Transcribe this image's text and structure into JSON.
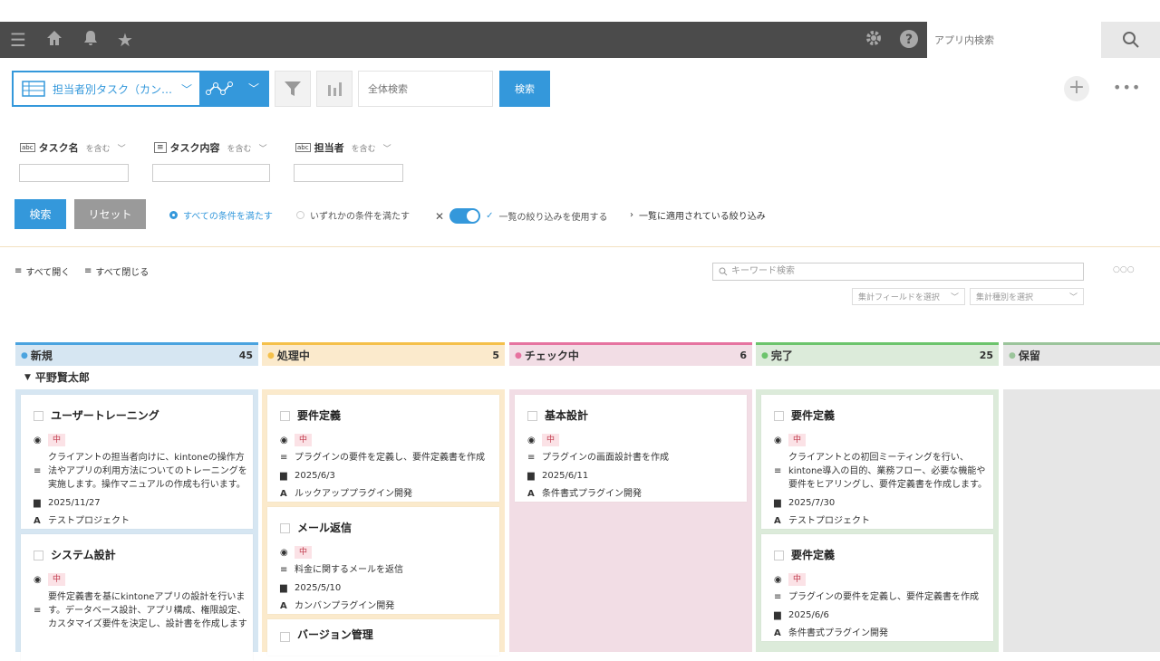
{
  "header": {
    "search_placeholder": "アプリ内検索"
  },
  "toolbar": {
    "view_label": "担当者別タスク（カン…",
    "allsearch_placeholder": "全体検索",
    "search_label": "検索"
  },
  "filters": {
    "fields": [
      {
        "label": "タスク名",
        "op": "を含む"
      },
      {
        "label": "タスク内容",
        "op": "を含む"
      },
      {
        "label": "担当者",
        "op": "を含む"
      }
    ],
    "search_label": "検索",
    "reset_label": "リセット",
    "match_all": "すべての条件を満たす",
    "match_any": "いずれかの条件を満たす",
    "use_list_filter": "一覧の絞り込みを使用する",
    "applied_filter": "一覧に適用されている絞り込み"
  },
  "kanban_bar": {
    "expand_all": "すべて開く",
    "collapse_all": "すべて閉じる",
    "keyword_placeholder": "キーワード検索",
    "agg_field": "集計フィールドを選択",
    "agg_type": "集計種別を選択"
  },
  "group": {
    "name": "平野賢太郎"
  },
  "columns": [
    {
      "name": "新規",
      "count": "45",
      "color": "#4aa3df",
      "bg": "#d6e6f2"
    },
    {
      "name": "処理中",
      "count": "5",
      "color": "#f5c04a",
      "bg": "#fbeacc"
    },
    {
      "name": "チェック中",
      "count": "6",
      "color": "#e673a0",
      "bg": "#f2dde5"
    },
    {
      "name": "完了",
      "count": "25",
      "color": "#6cc46c",
      "bg": "#dcebda"
    },
    {
      "name": "保留",
      "count": "",
      "color": "#9bc49b",
      "bg": "#e6e6e6"
    }
  ],
  "cards": {
    "c0": [
      {
        "title": "ユーザートレーニング",
        "priority": "中",
        "desc": "クライアントの担当者向けに、kintoneの操作方法やアプリの利用方法についてのトレーニングを実施します。操作マニュアルの作成も行います。",
        "date": "2025/11/27",
        "project": "テストプロジェクト"
      },
      {
        "title": "システム設計",
        "priority": "中",
        "desc": "要件定義書を基にkintoneアプリの設計を行います。データベース設計、アプリ構成、権限設定、カスタマイズ要件を決定し、設計書を作成します"
      }
    ],
    "c1": [
      {
        "title": "要件定義",
        "priority": "中",
        "desc": "プラグインの要件を定義し、要件定義書を作成",
        "date": "2025/6/3",
        "project": "ルックアッププラグイン開発"
      },
      {
        "title": "メール返信",
        "priority": "中",
        "desc": "料金に関するメールを返信",
        "date": "2025/5/10",
        "project": "カンバンプラグイン開発"
      },
      {
        "title": "バージョン管理"
      }
    ],
    "c2": [
      {
        "title": "基本設計",
        "priority": "中",
        "desc": "プラグインの画面設計書を作成",
        "date": "2025/6/11",
        "project": "条件書式プラグイン開発"
      }
    ],
    "c3": [
      {
        "title": "要件定義",
        "priority": "中",
        "desc": "クライアントとの初回ミーティングを行い、kintone導入の目的、業務フロー、必要な機能や要件をヒアリングし、要件定義書を作成します。",
        "date": "2025/7/30",
        "project": "テストプロジェクト"
      },
      {
        "title": "要件定義",
        "priority": "中",
        "desc": "プラグインの要件を定義し、要件定義書を作成",
        "date": "2025/6/6",
        "project": "条件書式プラグイン開発"
      }
    ]
  }
}
